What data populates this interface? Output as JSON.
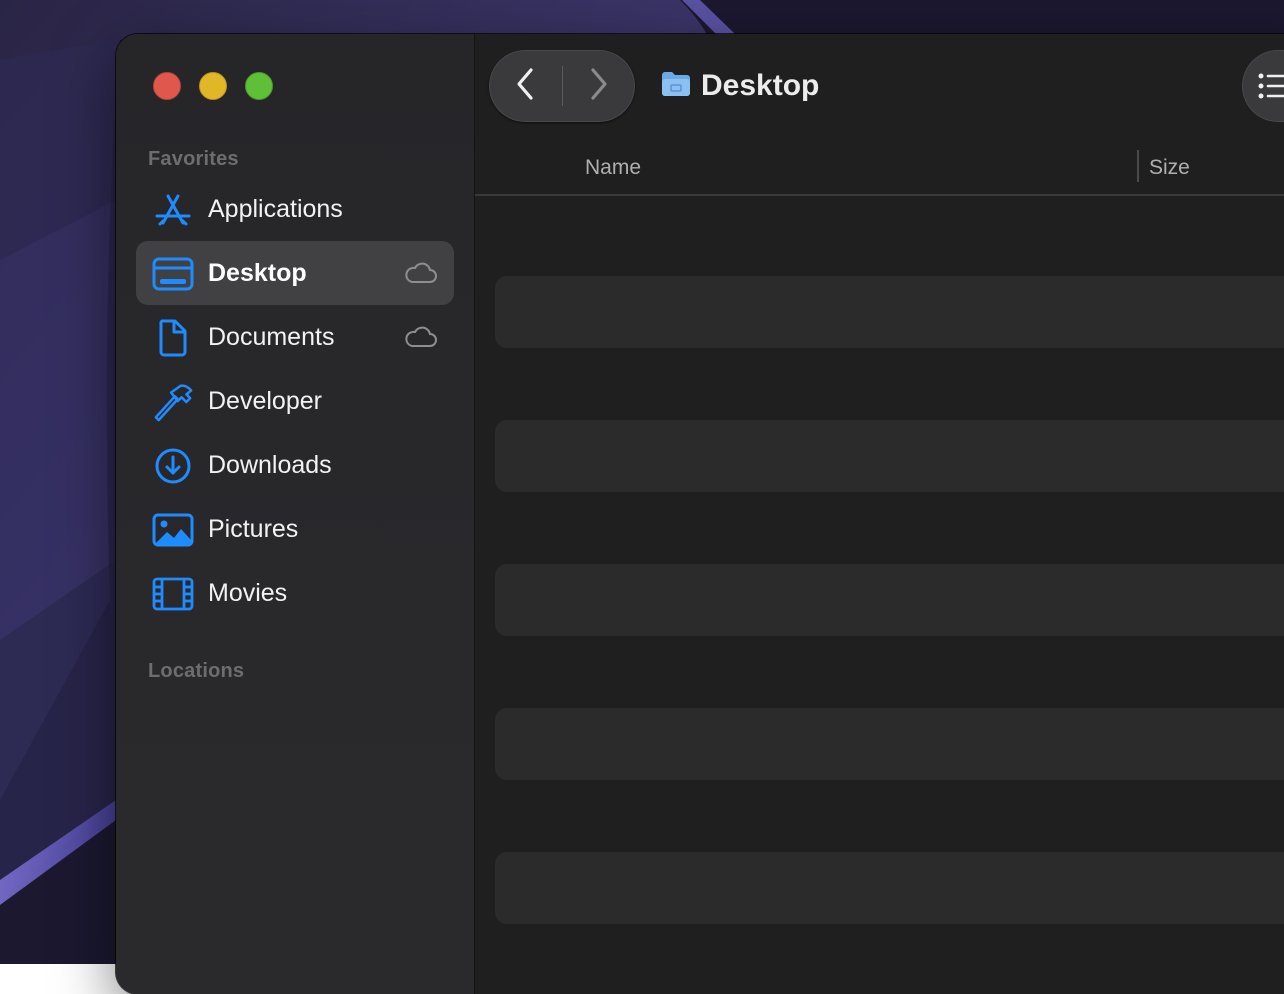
{
  "sidebar": {
    "favorites_label": "Favorites",
    "locations_label": "Locations",
    "items": [
      {
        "label": "Applications",
        "icon": "app-store-icon",
        "selected": false,
        "icloud": false
      },
      {
        "label": "Desktop",
        "icon": "desktop-icon",
        "selected": true,
        "icloud": true
      },
      {
        "label": "Documents",
        "icon": "document-icon",
        "selected": false,
        "icloud": true
      },
      {
        "label": "Developer",
        "icon": "hammer-icon",
        "selected": false,
        "icloud": false
      },
      {
        "label": "Downloads",
        "icon": "download-circle-icon",
        "selected": false,
        "icloud": false
      },
      {
        "label": "Pictures",
        "icon": "photo-icon",
        "selected": false,
        "icloud": false
      },
      {
        "label": "Movies",
        "icon": "film-icon",
        "selected": false,
        "icloud": false
      }
    ]
  },
  "toolbar": {
    "title": "Desktop",
    "title_icon": "folder-icon",
    "back_icon": "chevron-left-icon",
    "forward_icon": "chevron-right-icon",
    "view_icon": "list-view-icon"
  },
  "columns": {
    "name": "Name",
    "size": "Size"
  },
  "colors": {
    "accent": "#1e8bff",
    "selection": "#414144",
    "window_bg": "#1e1e1e",
    "row_stripe": "#2b2b2b"
  }
}
